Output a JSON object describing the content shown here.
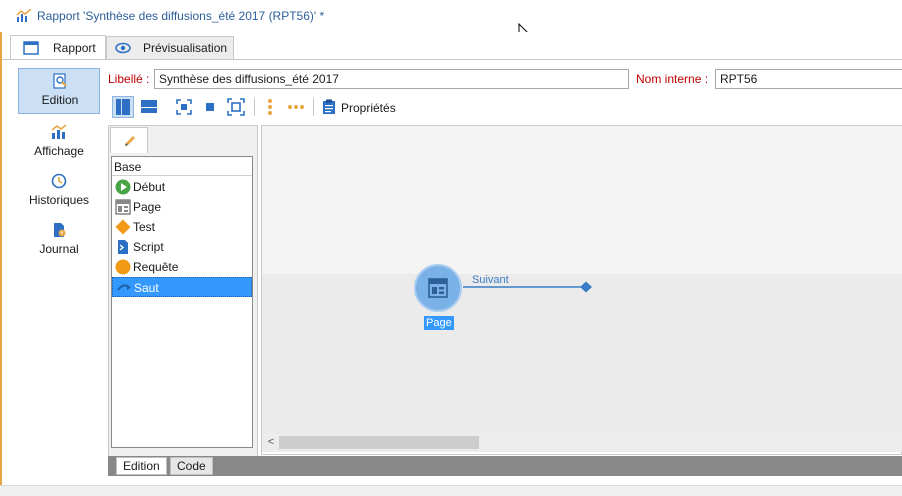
{
  "window": {
    "title": "Rapport 'Synthèse des diffusions_été 2017 (RPT56)' *"
  },
  "tabs": [
    {
      "label": "Rapport",
      "icon": "form-icon",
      "active": true
    },
    {
      "label": "Prévisualisation",
      "icon": "eye-icon",
      "active": false
    }
  ],
  "nav": {
    "items": [
      {
        "label": "Edition",
        "icon": "magnifier-page-icon",
        "active": true
      },
      {
        "label": "Affichage",
        "icon": "chart-icon",
        "active": false
      },
      {
        "label": "Historiques",
        "icon": "clock-icon",
        "active": false
      },
      {
        "label": "Journal",
        "icon": "journal-icon",
        "active": false
      }
    ]
  },
  "form": {
    "libelle_label": "Libellé :",
    "libelle_value": "Synthèse des diffusions_été 2017",
    "nom_interne_label": "Nom interne :",
    "nom_interne_value": "RPT56"
  },
  "toolbar": {
    "properties_label": "Propriétés"
  },
  "palette": {
    "header": "Base",
    "items": [
      {
        "label": "Début",
        "icon": "play-circle-icon"
      },
      {
        "label": "Page",
        "icon": "page-layout-icon"
      },
      {
        "label": "Test",
        "icon": "diamond-icon"
      },
      {
        "label": "Script",
        "icon": "script-icon"
      },
      {
        "label": "Requête",
        "icon": "query-circle-icon"
      },
      {
        "label": "Saut",
        "icon": "jump-icon",
        "selected": true
      }
    ]
  },
  "canvas": {
    "node_label": "Page",
    "transition_label": "Suivant"
  },
  "bottom_tabs": [
    {
      "label": "Edition",
      "active": true
    },
    {
      "label": "Code",
      "active": false
    }
  ],
  "colors": {
    "accent": "#3399ff",
    "label_red": "#c00000",
    "title_blue": "#2d5f9a",
    "node_blue": "#7ab1e6"
  }
}
